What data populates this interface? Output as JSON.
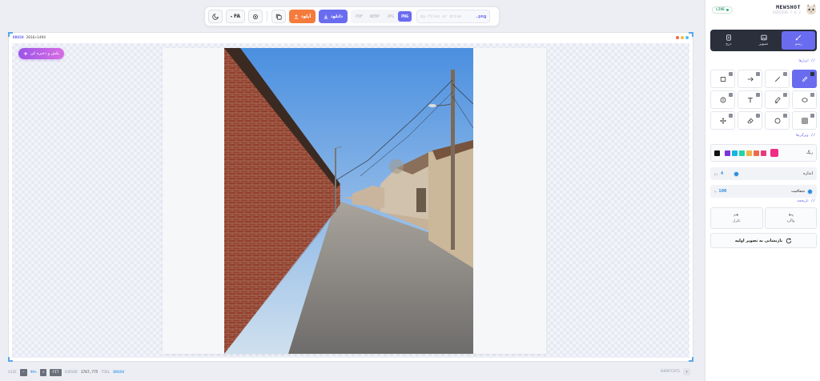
{
  "toolbar": {
    "lang_label": "FA",
    "upload_label": "آپلود",
    "download_label": "دانلود",
    "formats": [
      "PDF",
      "WEBP",
      "JPG",
      "PNG"
    ],
    "active_format": "PNG",
    "filename_placeholder": "my-files or drive",
    "filename_ext": ".png"
  },
  "canvas": {
    "mode_tag": "BRUSH",
    "dimensions": "2016×1494",
    "save_button_label": "بکش و ذخیره کن",
    "window_dot_colors": [
      "#f4664a",
      "#f5b83d",
      "#4bc0f0"
    ]
  },
  "statusbar": {
    "left_label": "SIZE",
    "zoom": "49%",
    "cursor_label": "CURSOR",
    "cursor": "1767,775",
    "tool_label": "TOOL",
    "tool": "BRUSH",
    "right_label": "SHORTCUTS"
  },
  "panel": {
    "live_label": "LIVE",
    "brand_name": "MEWSHOT",
    "brand_version": "VERSION 7.6.2",
    "tabs": [
      {
        "label": "رسم",
        "icon": "brush-icon"
      },
      {
        "label": "تصویر",
        "icon": "image-icon"
      },
      {
        "label": "درج",
        "icon": "insert-icon"
      }
    ],
    "active_tab": "رسم",
    "tools_label": "ابزارها",
    "props_label": "ویژگی‌ها",
    "history_label": "تاریخچه",
    "color_label": "رنگ",
    "swatches": [
      "#111111",
      "#7b35e0",
      "#17b6e0",
      "#22d4a8",
      "#f0b24a",
      "#ef6b4a",
      "#e83a7f"
    ],
    "selected_color": "#ef2d86",
    "size_label": "اندازه",
    "size_value": "4",
    "size_unit": "px",
    "opacity_label": "شفافیت",
    "opacity_value": "100",
    "opacity_unit": "%",
    "undo_label": "واگرد",
    "redo_label": "تکرار",
    "reset_label": "بازنشانی به تصویر اولیه"
  },
  "colors": {
    "accent": "#6a6cf0",
    "upload": "#f47b3c",
    "dark_tab_bg": "#2a2f3b",
    "live_green": "#1fb57a"
  }
}
